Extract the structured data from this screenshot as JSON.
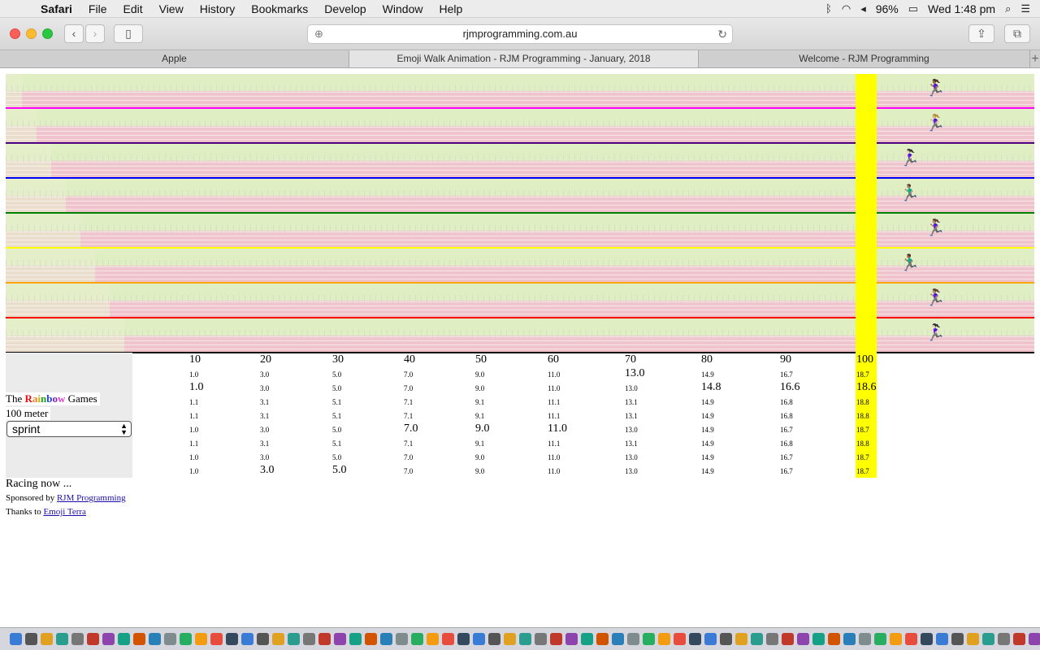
{
  "menubar": {
    "app": "Safari",
    "items": [
      "File",
      "Edit",
      "View",
      "History",
      "Bookmarks",
      "Develop",
      "Window",
      "Help"
    ],
    "battery": "96%",
    "clock": "Wed 1:48 pm"
  },
  "toolbar": {
    "url": "rjmprogramming.com.au"
  },
  "tabs": [
    {
      "label": "Apple"
    },
    {
      "label": "Emoji Walk Animation - RJM Programming - January, 2018"
    },
    {
      "label": "Welcome - RJM Programming"
    }
  ],
  "lane_colors": [
    "#ff00ff",
    "#4b0082",
    "#0000ff",
    "#008000",
    "#ffff00",
    "#ffa500",
    "#ff0000",
    "#000000"
  ],
  "runners": [
    {
      "icon": "runner-icon",
      "glyph": "🏃🏾‍♀️",
      "distance": 103
    },
    {
      "icon": "runner-icon",
      "glyph": "🏃🏼‍♀️",
      "distance": 103
    },
    {
      "icon": "runner-icon",
      "glyph": "🏃🏻‍♀️",
      "distance": 100
    },
    {
      "icon": "runner-icon",
      "glyph": "🏃🏽‍♂️",
      "distance": 100
    },
    {
      "icon": "runner-icon",
      "glyph": "🏃🏽‍♀️",
      "distance": 103
    },
    {
      "icon": "runner-icon",
      "glyph": "🏃🏾‍♂️",
      "distance": 100
    },
    {
      "icon": "runner-icon",
      "glyph": "🏃🏽‍♀️",
      "distance": 103
    },
    {
      "icon": "runner-icon",
      "glyph": "🏃🏻‍♀️",
      "distance": 103
    }
  ],
  "results": {
    "headers": [
      "10",
      "20",
      "30",
      "40",
      "50",
      "60",
      "70",
      "80",
      "90",
      "100"
    ],
    "rows": [
      [
        "1.0",
        "3.0",
        "5.0",
        "7.0",
        "9.0",
        "11.0",
        "13.0",
        "14.9",
        "16.7",
        "18.7"
      ],
      [
        "1.0",
        "3.0",
        "5.0",
        "7.0",
        "9.0",
        "11.0",
        "13.0",
        "14.8",
        "16.6",
        "18.6"
      ],
      [
        "1.1",
        "3.1",
        "5.1",
        "7.1",
        "9.1",
        "11.1",
        "13.1",
        "14.9",
        "16.8",
        "18.8"
      ],
      [
        "1.1",
        "3.1",
        "5.1",
        "7.1",
        "9.1",
        "11.1",
        "13.1",
        "14.9",
        "16.8",
        "18.8"
      ],
      [
        "1.0",
        "3.0",
        "5.0",
        "7.0",
        "9.0",
        "11.0",
        "13.0",
        "14.9",
        "16.7",
        "18.7"
      ],
      [
        "1.1",
        "3.1",
        "5.1",
        "7.1",
        "9.1",
        "11.1",
        "13.1",
        "14.9",
        "16.8",
        "18.8"
      ],
      [
        "1.0",
        "3.0",
        "5.0",
        "7.0",
        "9.0",
        "11.0",
        "13.0",
        "14.9",
        "16.7",
        "18.7"
      ],
      [
        "1.0",
        "3.0",
        "5.0",
        "7.0",
        "9.0",
        "11.0",
        "13.0",
        "14.9",
        "16.7",
        "18.7"
      ]
    ],
    "leaders": [
      [
        false,
        false,
        false,
        false,
        false,
        false,
        true,
        false,
        false,
        false
      ],
      [
        true,
        false,
        false,
        false,
        false,
        false,
        false,
        true,
        true,
        true
      ],
      [
        false,
        false,
        false,
        false,
        false,
        false,
        false,
        false,
        false,
        false
      ],
      [
        false,
        false,
        false,
        false,
        false,
        false,
        false,
        false,
        false,
        false
      ],
      [
        false,
        false,
        false,
        true,
        true,
        true,
        false,
        false,
        false,
        false
      ],
      [
        false,
        false,
        false,
        false,
        false,
        false,
        false,
        false,
        false,
        false
      ],
      [
        false,
        false,
        false,
        false,
        false,
        false,
        false,
        false,
        false,
        false
      ],
      [
        false,
        true,
        true,
        false,
        false,
        false,
        false,
        false,
        false,
        false
      ]
    ]
  },
  "sidebar": {
    "title_prefix": "The",
    "rainbow_letters": [
      "R",
      "a",
      "i",
      "n",
      "b",
      "o",
      "w"
    ],
    "title_suffix": "Games",
    "distance": "100 meter",
    "event": "sprint"
  },
  "status": "Racing now ...",
  "sponsor": {
    "text": "Sponsored by",
    "link": "RJM Programming"
  },
  "thanks": {
    "text": "Thanks to",
    "link": "Emoji Terra"
  }
}
